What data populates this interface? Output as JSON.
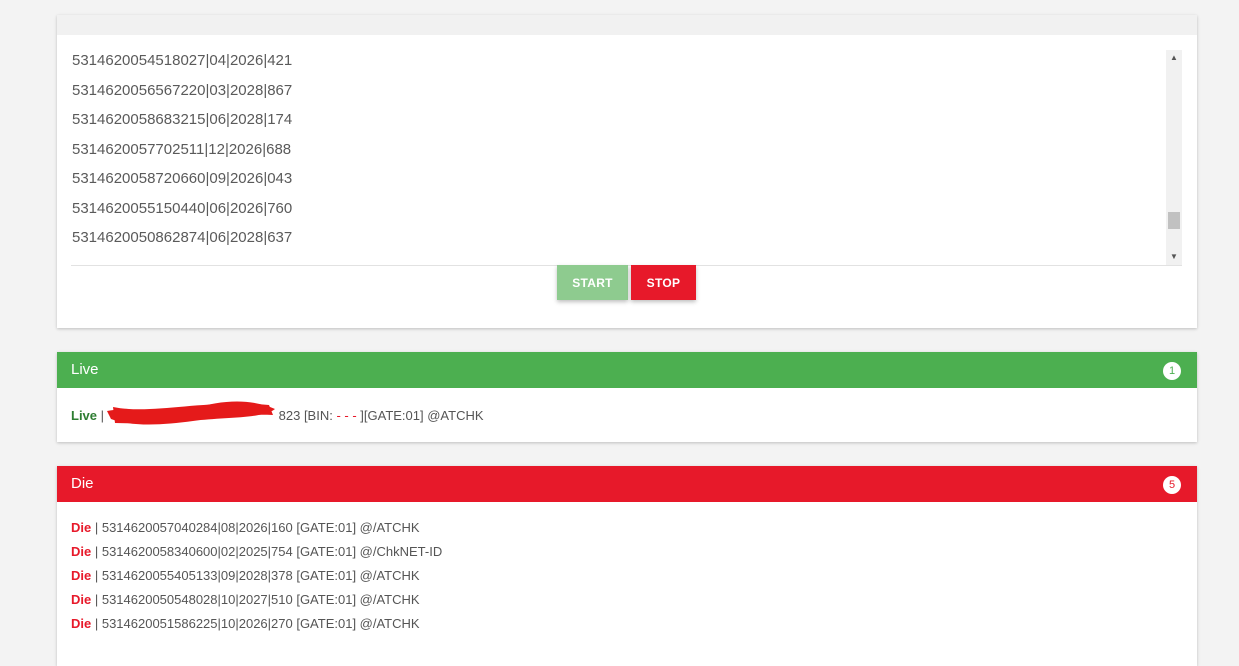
{
  "input": {
    "lines": [
      "5314620054518027|04|2026|421",
      "5314620056567220|03|2028|867",
      "5314620058683215|06|2028|174",
      "5314620057702511|12|2026|688",
      "5314620058720660|09|2026|043",
      "5314620055150440|06|2026|760",
      "5314620050862874|06|2028|637"
    ]
  },
  "buttons": {
    "start": "START",
    "stop": "STOP"
  },
  "live": {
    "title": "Live",
    "count": "1",
    "rows": [
      {
        "tag": "Live",
        "sep": " | ",
        "card_suffix": "823",
        "bin_label": " [BIN: ",
        "bin": "- - -",
        "after_bin": " ][GATE:01] @ATCHK"
      }
    ]
  },
  "die": {
    "title": "Die",
    "count": "5",
    "rows": [
      {
        "tag": "Die",
        "text": " | 5314620057040284|08|2026|160 [GATE:01] @/ATCHK"
      },
      {
        "tag": "Die",
        "text": " | 5314620058340600|02|2025|754 [GATE:01] @/ChkNET-ID"
      },
      {
        "tag": "Die",
        "text": " | 5314620055405133|09|2028|378 [GATE:01] @/ATCHK"
      },
      {
        "tag": "Die",
        "text": " | 5314620050548028|10|2027|510 [GATE:01] @/ATCHK"
      },
      {
        "tag": "Die",
        "text": " | 5314620051586225|10|2026|270 [GATE:01] @/ATCHK"
      }
    ]
  },
  "colors": {
    "live": "#4caf50",
    "die": "#e7192a",
    "start": "#8ecb8f"
  },
  "icons": {
    "scroll_up": "triangle-up-icon",
    "scroll_down": "triangle-down-icon"
  }
}
